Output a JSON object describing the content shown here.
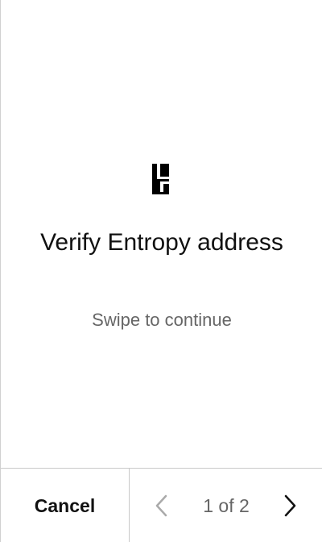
{
  "screen": {
    "logo_icon": "entropy-logo-icon",
    "title": "Verify Entropy address",
    "subtitle": "Swipe to continue"
  },
  "footer": {
    "cancel_label": "Cancel",
    "pager": {
      "label": "1 of 2",
      "prev_icon": "chevron-left-icon",
      "next_icon": "chevron-right-icon",
      "prev_color": "#aaaaaa",
      "next_color": "#111111"
    }
  }
}
